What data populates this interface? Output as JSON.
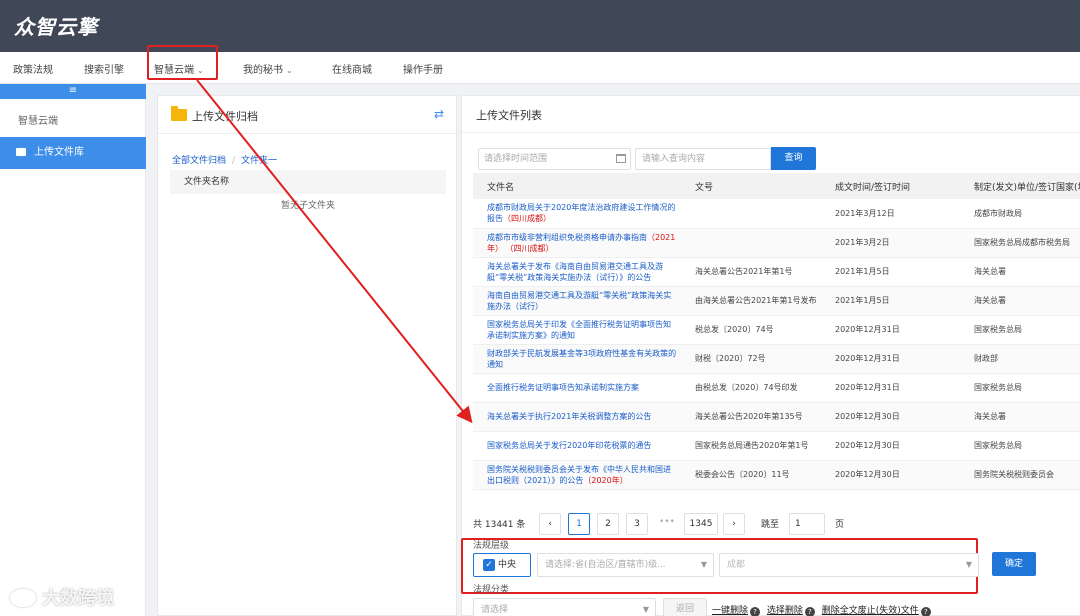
{
  "app": {
    "logo": "众智云擎"
  },
  "nav": {
    "items": [
      {
        "label": "政策法规"
      },
      {
        "label": "搜索引擎"
      },
      {
        "label": "智慧云端"
      },
      {
        "label": "我的秘书"
      },
      {
        "label": "在线商城"
      },
      {
        "label": "操作手册"
      }
    ]
  },
  "sidebar": {
    "toggle": "≡",
    "title": "智慧云端",
    "items": [
      {
        "label": "上传文件库"
      }
    ]
  },
  "archive": {
    "title": "上传文件归档",
    "breadcrumb": [
      "全部文件归档",
      "文件夹一"
    ],
    "column": "文件夹名称",
    "empty": "暂无子文件夹"
  },
  "list": {
    "title": "上传文件列表",
    "date_placeholder": "请选择时间范围",
    "query_placeholder": "请输入查询内容",
    "query_button": "查询",
    "columns": [
      "文件名",
      "文号",
      "成文时间/签订时间",
      "制定(发文)单位/签订国家(地"
    ],
    "rows": [
      {
        "name": "成都市财政局关于2020年度法治政府建设工作情况的报告",
        "tag": "（四川成都）",
        "doc": "",
        "date": "2021年3月12日",
        "org": "成都市财政局"
      },
      {
        "name": "成都市市级非营利组织免税资格申请办事指南",
        "tag": "（2021年） （四川成都）",
        "doc": "",
        "date": "2021年3月2日",
        "org": "国家税务总局成都市税务局"
      },
      {
        "name": "海关总署关于发布《海南自由贸易港交通工具及游艇“零关税”政策海关实施办法（试行）》的公告",
        "tag": "",
        "doc": "海关总署公告2021年第1号",
        "date": "2021年1月5日",
        "org": "海关总署"
      },
      {
        "name": "海南自由贸易港交通工具及游艇“零关税”政策海关实施办法（试行）",
        "tag": "",
        "doc": "由海关总署公告2021年第1号发布",
        "date": "2021年1月5日",
        "org": "海关总署"
      },
      {
        "name": "国家税务总局关于印发《全面推行税务证明事项告知承诺制实施方案》的通知",
        "tag": "",
        "doc": "税总发〔2020〕74号",
        "date": "2020年12月31日",
        "org": "国家税务总局"
      },
      {
        "name": "财政部关于民航发展基金等3项政府性基金有关政策的通知",
        "tag": "",
        "doc": "财税〔2020〕72号",
        "date": "2020年12月31日",
        "org": "财政部"
      },
      {
        "name": "全面推行税务证明事项告知承诺制实施方案",
        "tag": "",
        "doc": "由税总发〔2020〕74号印发",
        "date": "2020年12月31日",
        "org": "国家税务总局"
      },
      {
        "name": "海关总署关于执行2021年关税调整方案的公告",
        "tag": "",
        "doc": "海关总署公告2020年第135号",
        "date": "2020年12月30日",
        "org": "海关总署"
      },
      {
        "name": "国家税务总局关于发行2020年印花税票的通告",
        "tag": "",
        "doc": "国家税务总局通告2020年第1号",
        "date": "2020年12月30日",
        "org": "国家税务总局"
      },
      {
        "name": "国务院关税税则委员会关于发布《中华人民共和国进出口税则（2021）》的公告",
        "tag": "（2020年）",
        "doc": "税委会公告〔2020〕11号",
        "date": "2020年12月30日",
        "org": "国务院关税税则委员会"
      }
    ]
  },
  "pagination": {
    "total": "共 13441 条",
    "prev": "‹",
    "pages": [
      "1",
      "2",
      "3"
    ],
    "dots": "•••",
    "last": "1345",
    "next": "›",
    "jump_label": "跳至",
    "jump_value": "1",
    "page_suffix": "页"
  },
  "filter": {
    "level_label": "法规层级",
    "center": "中央",
    "province_placeholder": "请选择:省(自治区/直辖市)级...",
    "city_value": "成都",
    "confirm": "确定",
    "category_label": "法规分类",
    "category_placeholder": "请选择",
    "back": "返回",
    "links": [
      "一键删除",
      "选择删除",
      "删除全文废止(失效)文件"
    ]
  },
  "watermark": "大数跨境"
}
